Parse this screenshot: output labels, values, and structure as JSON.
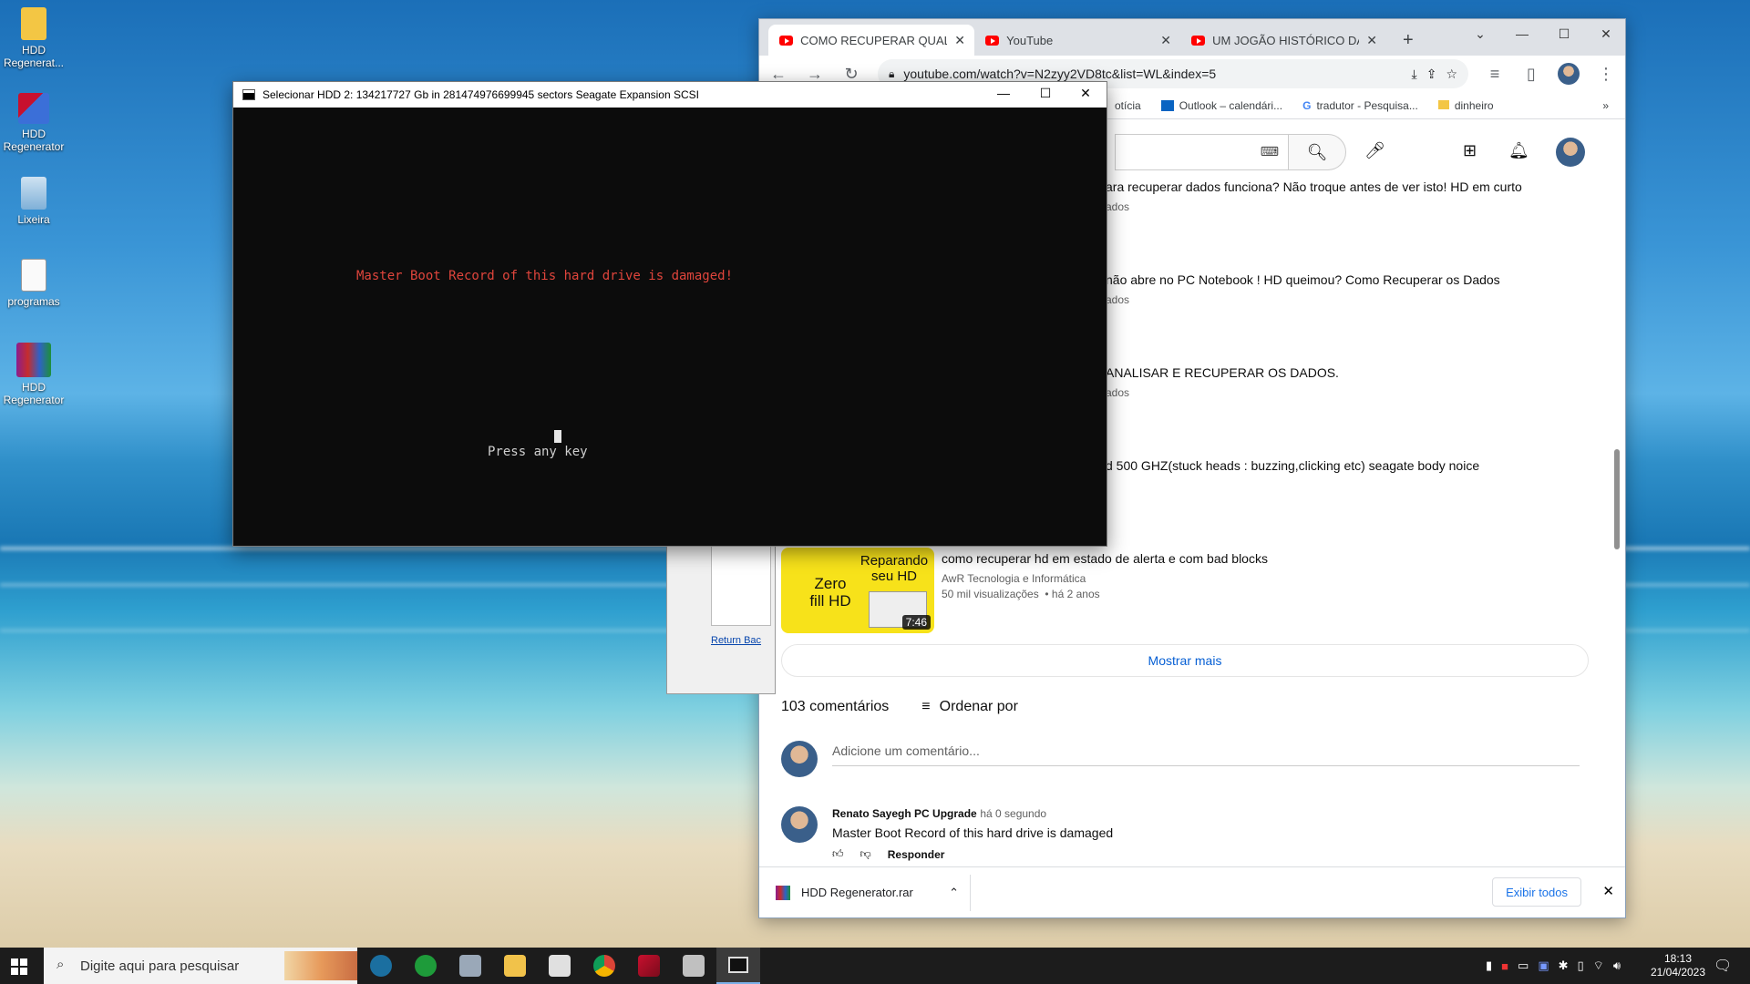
{
  "desktop": {
    "icons": [
      {
        "label": "HDD\nRegenerat..."
      },
      {
        "label": "HDD\nRegenerator"
      },
      {
        "label": "Lixeira"
      },
      {
        "label": "programas"
      },
      {
        "label": "HDD\nRegenerator"
      }
    ]
  },
  "chrome": {
    "tabs": [
      {
        "title": "COMO RECUPERAR QUALQUE"
      },
      {
        "title": "YouTube"
      },
      {
        "title": "UM JOGÃO HISTÓRICO DA FU"
      }
    ],
    "new_tab": "+",
    "url": "youtube.com/watch?v=N2zyy2VD8tc&list=WL&index=5",
    "bookmarks": [
      "otícia",
      "Outlook – calendári...",
      "tradutor - Pesquisa...",
      "dinheiro"
    ],
    "more_bookmarks": "»"
  },
  "youtube": {
    "videos": [
      {
        "title": "ara recuperar dados funciona? Não troque antes de ver isto! HD em curto",
        "meta": "ados"
      },
      {
        "title": "não abre no PC Notebook ! HD queimou? Como Recuperar os Dados",
        "meta": "ados"
      },
      {
        "title": "ANALISAR E RECUPERAR OS DADOS.",
        "meta": "ados"
      },
      {
        "title": "d 500 GHZ(stuck heads : buzzing,clicking etc) seagate body noice",
        "meta": ""
      },
      {
        "title": "como recuperar hd em estado de alerta e com bad blocks",
        "channel": "AwR Tecnologia e Informática",
        "views": "50 mil visualizações",
        "age": "há 2 anos"
      }
    ],
    "thumb": {
      "text1": "Reparando seu HD",
      "text2": "Zero fill HD",
      "duration": "7:46"
    },
    "show_more": "Mostrar mais",
    "comments_count": "103 comentários",
    "sort_by": "Ordenar por",
    "add_comment_placeholder": "Adicione um comentário...",
    "comment": {
      "author": "Renato Sayegh PC Upgrade",
      "time": "há 0 segundo",
      "text": "Master Boot Record of this hard drive is damaged",
      "reply": "Responder"
    }
  },
  "back_dialog": {
    "link": "Return Bac"
  },
  "download": {
    "file": "HDD Regenerator.rar",
    "show_all": "Exibir todos"
  },
  "console": {
    "title": "Selecionar HDD 2: 134217727 Gb in 281474976699945 sectors  Seagate Expansion SCSI",
    "message": "Master Boot Record of this hard drive is damaged!",
    "prompt": "Press any key"
  },
  "taskbar": {
    "search_placeholder": "Digite aqui para pesquisar",
    "time": "18:13",
    "date": "21/04/2023"
  }
}
